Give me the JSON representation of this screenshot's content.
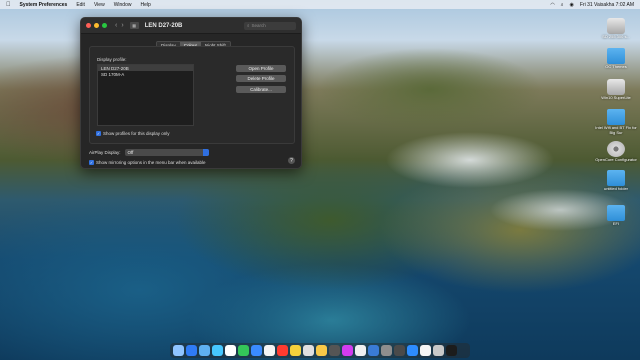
{
  "menubar": {
    "apple": "",
    "app_name": "System Preferences",
    "menus": [
      "Edit",
      "View",
      "Window",
      "Help"
    ],
    "clock": "Fri 31 Vaisakha  7:02 AM"
  },
  "window": {
    "title": "LEN D27-20B",
    "search_placeholder": "Search",
    "tabs": [
      "Display",
      "Colour",
      "Night Shift"
    ],
    "active_tab": "Colour",
    "profiles_label": "Display profile:",
    "profiles": [
      "LEN D27-20B",
      "SD 170M-A"
    ],
    "buttons": [
      "Open Profile",
      "Delete Profile",
      "Calibrate..."
    ],
    "show_profiles_label": "Show profiles for this display only",
    "airplay_label": "AirPlay Display:",
    "airplay_value": "Off",
    "mirroring_label": "Show mirroring options in the menu bar when available",
    "help": "?"
  },
  "desktop_icons": [
    {
      "label": "SD 255 300 s...",
      "icon": "disk-icon"
    },
    {
      "label": "OC Themes",
      "icon": "folder-icon"
    },
    {
      "label": "Win10 SuperLite",
      "icon": "disk-icon"
    },
    {
      "label": "Intel Wifi and BT Fix for Big Sur",
      "icon": "folder-icon"
    },
    {
      "label": "OpenCore Configurator",
      "icon": "cd-icon"
    },
    {
      "label": "untitled folder",
      "icon": "folder-icon"
    },
    {
      "label": "EFI",
      "icon": "folder-icon"
    }
  ],
  "dock_colors": [
    "#8fc4ff",
    "#2f7bf5",
    "#5fb0f0",
    "#46c7ff",
    "#ffffff",
    "#34c759",
    "#3a8bff",
    "#f5f5f5",
    "#ff3b30",
    "#f4d13b",
    "#e0e0e0",
    "#f7c948",
    "#555555",
    "#d23cf0",
    "#f0f0f0",
    "#3a7bd5",
    "#8e8e8e",
    "#4a4a4a",
    "#2d8cff",
    "#f5f5f5",
    "#c8c8c8",
    "#1c1c1c"
  ]
}
